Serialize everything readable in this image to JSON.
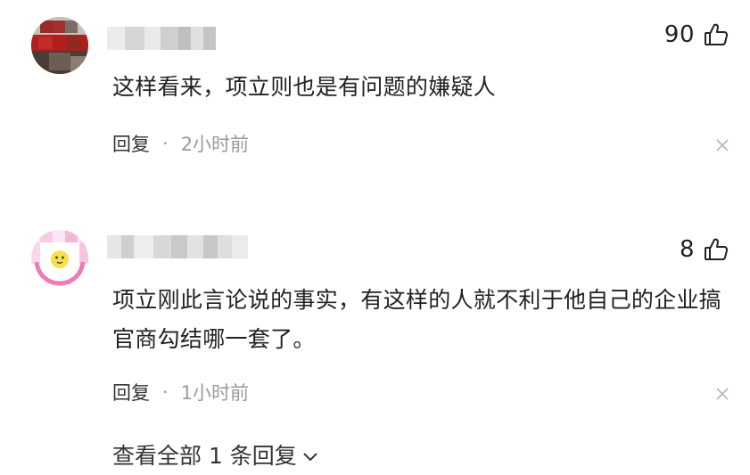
{
  "comments": [
    {
      "likes": "90",
      "text": "这样看来，项立则也是有问题的嫌疑人",
      "reply_label": "回复",
      "separator": "·",
      "time": "2小时前"
    },
    {
      "likes": "8",
      "text": "项立刚此言论说的事实，有这样的人就不利于他自己的企业搞官商勾结哪一套了。",
      "reply_label": "回复",
      "separator": "·",
      "time": "1小时前"
    }
  ],
  "expand_replies": "查看全部 1 条回复",
  "icons": {
    "like": "thumbs-up-icon",
    "close": "close-icon",
    "expand": "chevron-down-icon"
  }
}
